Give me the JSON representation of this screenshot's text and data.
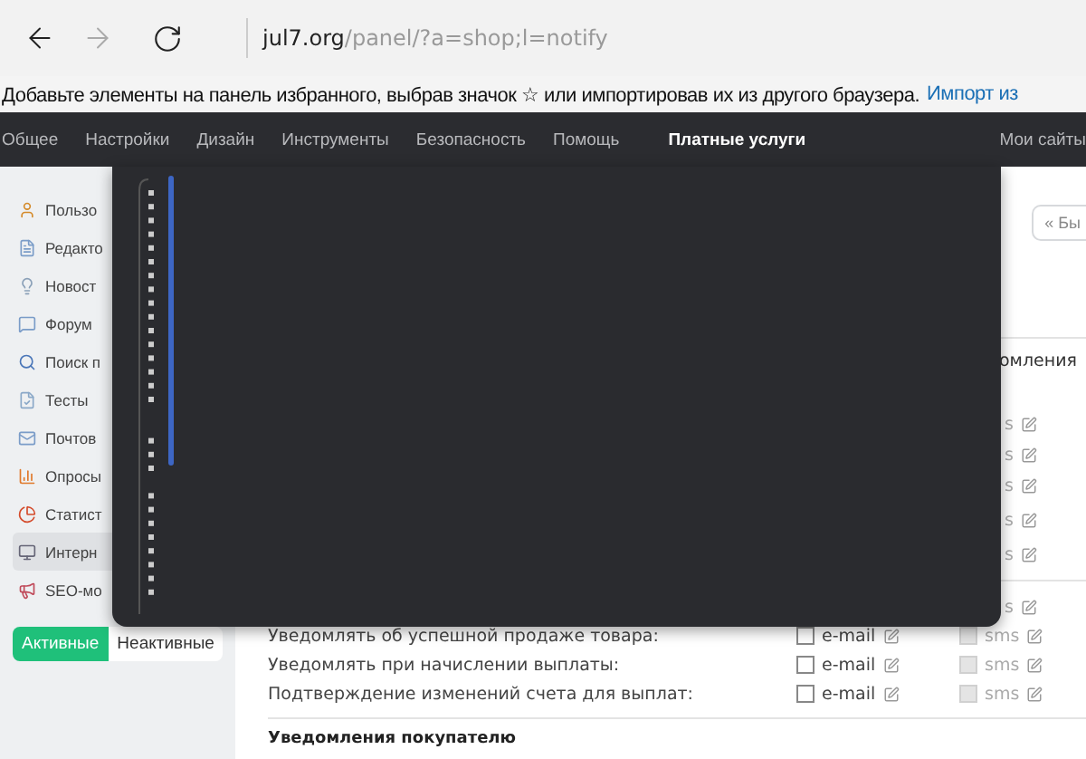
{
  "browser": {
    "url_host": "jul7.org",
    "url_path": "/panel/?a=shop;l=notify"
  },
  "favorites_bar": {
    "message": "Добавьте элементы на панель избранного, выбрав значок ☆ или импортировав их из другого браузера.",
    "link": "Импорт из"
  },
  "nav": [
    {
      "label": "Общее",
      "selected": false
    },
    {
      "label": "Настройки",
      "selected": false
    },
    {
      "label": "Дизайн",
      "selected": false
    },
    {
      "label": "Инструменты",
      "selected": false
    },
    {
      "label": "Безопасность",
      "selected": false
    },
    {
      "label": "Помощь",
      "selected": false
    },
    {
      "label": "Платные услуги",
      "selected": true
    }
  ],
  "nav_right": "Мои сайты",
  "sidebar": {
    "items": [
      {
        "label": "Пользо",
        "selected": false
      },
      {
        "label": "Редакто",
        "selected": false
      },
      {
        "label": "Новост",
        "selected": false
      },
      {
        "label": "Форум",
        "selected": false
      },
      {
        "label": "Поиск п",
        "selected": false
      },
      {
        "label": "Тесты",
        "selected": false
      },
      {
        "label": "Почтов",
        "selected": false
      },
      {
        "label": "Опросы",
        "selected": false
      },
      {
        "label": "Статист",
        "selected": false
      },
      {
        "label": "Интерн",
        "selected": true
      },
      {
        "label": "SEO-мо",
        "selected": false
      }
    ],
    "tabs": [
      {
        "label": "Активные",
        "selected": true
      },
      {
        "label": "Неактивные",
        "selected": false
      }
    ]
  },
  "main": {
    "back_button": "« Бы",
    "column_header": "омления",
    "covered_rows": [
      {
        "sms": "s"
      },
      {
        "sms": "s"
      },
      {
        "sms": "s"
      },
      {
        "sms": "s"
      },
      {
        "sms": "s"
      }
    ],
    "covered_rows_2": [
      {
        "sms": "s"
      }
    ],
    "rows": [
      {
        "label": "Уведомлять об успешной продаже товара:",
        "email": "e-mail",
        "email_checked": false,
        "sms": "sms",
        "sms_disabled": true
      },
      {
        "label": "Уведомлять при начислении выплаты:",
        "email": "e-mail",
        "email_checked": false,
        "sms": "sms",
        "sms_disabled": true
      },
      {
        "label": "Подтверждение изменений счета для выплат:",
        "email": "e-mail",
        "email_checked": false,
        "sms": "sms",
        "sms_disabled": true
      }
    ],
    "section_title": "Уведомления покупателю"
  }
}
